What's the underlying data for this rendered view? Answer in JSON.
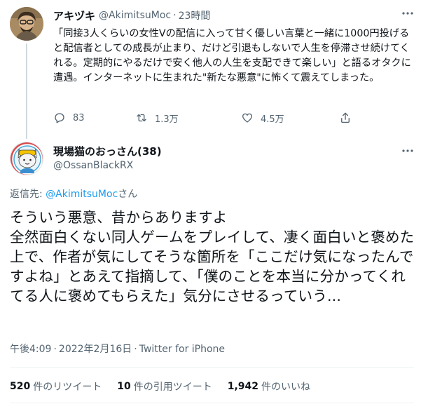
{
  "parent_tweet": {
    "display_name": "アキヅキ",
    "handle": "@AkimitsuMoc",
    "separator": "·",
    "time": "23時間",
    "text": "「同接3人くらいの女性Vの配信に入って甘く優しい言葉と一緒に1000円投げると配信者としての成長が止まり、だけど引退もしないで人生を停滞させ続けてくれる。定期的にやるだけで安く他人の人生を支配できて楽しい」と語るオタクに遭遇。インターネットに生まれた\"新たな悪意\"に怖くて震えてしまった。",
    "actions": {
      "reply_count": "83",
      "retweet_count": "1.3万",
      "like_count": "4.5万"
    }
  },
  "main_tweet": {
    "display_name": "現場猫のおっさん(38)",
    "handle": "@OssanBlackRX",
    "reply_prefix": "返信先: ",
    "reply_mention": "@AkimitsuMoc",
    "reply_suffix": "さん",
    "text": "そういう悪意、昔からありますよ\n全然面白くない同人ゲームをプレイして、凄く面白いと褒めた上で、作者が気にしてそうな箇所を「ここだけ気になったんですよね」とあえて指摘して、「僕のことを本当に分かってくれてる人に褒めてもらえた」気分にさせるっていう...",
    "time": "午後4:09",
    "separator": "·",
    "date": "2022年2月16日",
    "source": "Twitter for iPhone"
  },
  "stats": {
    "retweets_value": "520",
    "retweets_label": "件のリツイート",
    "quotes_value": "10",
    "quotes_label": "件の引用ツイート",
    "likes_value": "1,942",
    "likes_label": "件のいいね"
  },
  "colors": {
    "link": "#1d9bf0",
    "muted": "#536471",
    "text": "#0f1419"
  },
  "icons": [
    "more-icon",
    "reply-icon",
    "retweet-icon",
    "like-icon",
    "share-icon"
  ]
}
